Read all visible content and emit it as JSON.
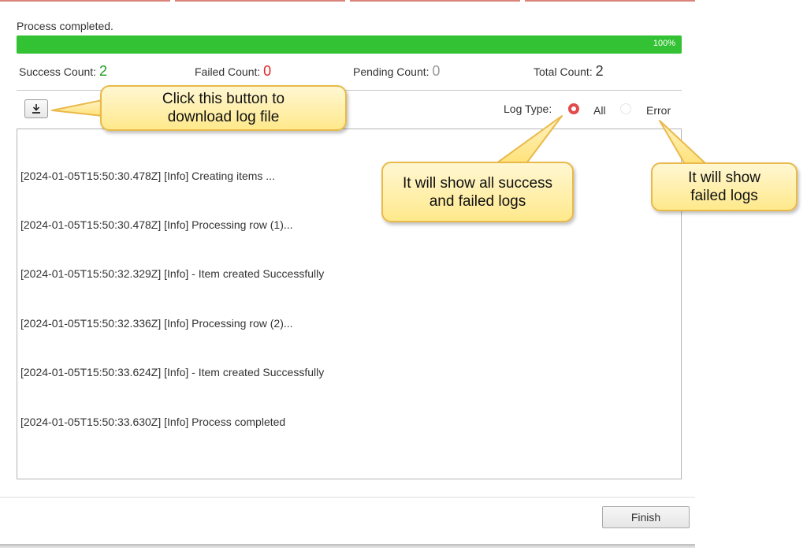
{
  "status": {
    "text": "Process completed."
  },
  "progress": {
    "percent": 100,
    "label": "100%",
    "fill_color": "#33c233"
  },
  "counts": {
    "success": {
      "label": "Success Count:",
      "value": "2",
      "color": "#1f9d1f"
    },
    "failed": {
      "label": "Failed Count:",
      "value": "0",
      "color": "#e02424"
    },
    "pending": {
      "label": "Pending Count:",
      "value": "0",
      "color": "#9a9a9a"
    },
    "total": {
      "label": "Total Count:",
      "value": "2",
      "color": "#333333"
    }
  },
  "toolbar": {
    "download_icon": "download-icon"
  },
  "log_type": {
    "label": "Log Type:",
    "options": [
      {
        "label": "All",
        "selected": true
      },
      {
        "label": "Error",
        "selected": false
      }
    ],
    "accent_color": "#e24b4b"
  },
  "log": {
    "lines": [
      "[2024-01-05T15:50:30.478Z] [Info] Creating items ...",
      "[2024-01-05T15:50:30.478Z] [Info] Processing row (1)...",
      "[2024-01-05T15:50:32.329Z] [Info] - Item created Successfully",
      "[2024-01-05T15:50:32.336Z] [Info] Processing row (2)...",
      "[2024-01-05T15:50:33.624Z] [Info] - Item created Successfully",
      "[2024-01-05T15:50:33.630Z] [Info] Process completed"
    ]
  },
  "footer": {
    "finish_label": "Finish"
  },
  "callouts": {
    "download": {
      "line1": "Click this button to",
      "line2": "download log file"
    },
    "all": {
      "line1": "It will show all success",
      "line2": "and failed logs"
    },
    "error": {
      "line1": "It will show",
      "line2": "failed logs"
    }
  }
}
